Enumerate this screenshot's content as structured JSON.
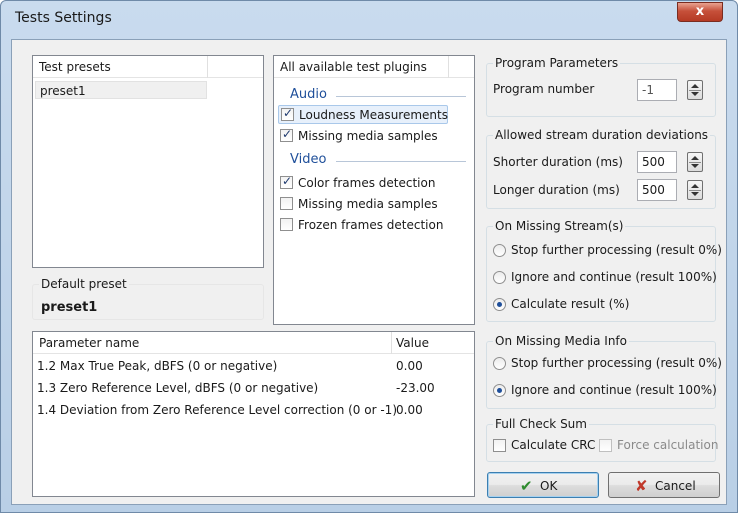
{
  "window": {
    "title": "Tests Settings",
    "close_label": "x"
  },
  "presets": {
    "header": "Test presets",
    "items": [
      "preset1"
    ],
    "default_label": "Default preset",
    "default_value": "preset1"
  },
  "plugins": {
    "header": "All available test plugins",
    "audio_section": "Audio",
    "audio_items": [
      {
        "label": "Loudness Measurements",
        "checked": true
      },
      {
        "label": "Missing media samples",
        "checked": true
      }
    ],
    "video_section": "Video",
    "video_items": [
      {
        "label": "Color frames detection",
        "checked": true
      },
      {
        "label": "Missing media samples",
        "checked": false
      },
      {
        "label": "Frozen frames detection",
        "checked": false
      }
    ]
  },
  "params_table": {
    "col_name": "Parameter name",
    "col_value": "Value",
    "rows": [
      {
        "name": "1.2 Max True Peak, dBFS (0 or negative)",
        "value": "0.00"
      },
      {
        "name": "1.3 Zero Reference Level, dBFS (0 or negative)",
        "value": "-23.00"
      },
      {
        "name": "1.4 Deviation from Zero Reference Level correction (0 or -1)",
        "value": "0.00"
      }
    ]
  },
  "program_params": {
    "title": "Program Parameters",
    "program_number_label": "Program number",
    "program_number_value": "-1"
  },
  "durations": {
    "title": "Allowed stream duration deviations",
    "shorter_label": "Shorter duration (ms)",
    "shorter_value": "500",
    "longer_label": "Longer duration (ms)",
    "longer_value": "500"
  },
  "missing_stream": {
    "title": "On Missing Stream(s)",
    "options": [
      {
        "label": "Stop further processing (result 0%)",
        "selected": false
      },
      {
        "label": "Ignore and continue (result 100%)",
        "selected": false
      },
      {
        "label": "Calculate result (%)",
        "selected": true
      }
    ]
  },
  "missing_media": {
    "title": "On Missing Media Info",
    "options": [
      {
        "label": "Stop further processing (result 0%)",
        "selected": false
      },
      {
        "label": "Ignore and continue (result 100%)",
        "selected": true
      }
    ]
  },
  "checksum": {
    "title": "Full Check Sum",
    "crc_label": "Calculate CRC",
    "crc_checked": false,
    "force_label": "Force calculation",
    "force_checked": false
  },
  "buttons": {
    "ok_label": "OK",
    "cancel_label": "Cancel"
  },
  "colors": {
    "accent": "#1f4f9a",
    "ok_icon": "#2e8b2e",
    "cancel_icon": "#c0392b",
    "disabled_text": "#8a8a8a"
  }
}
